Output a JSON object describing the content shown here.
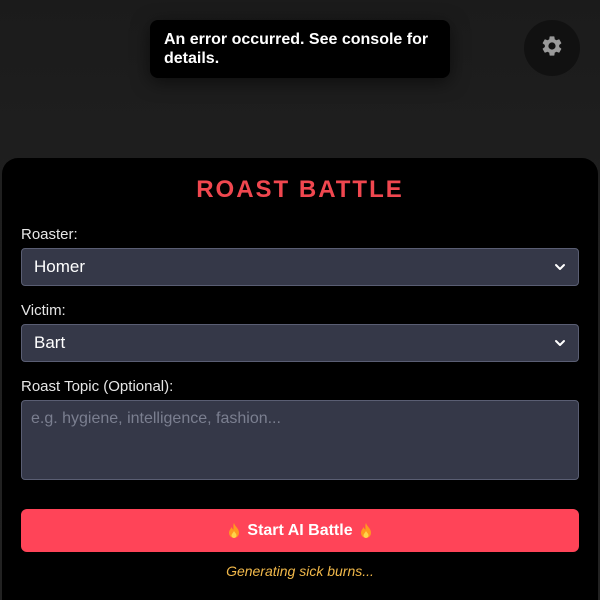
{
  "toast": {
    "message": "An error occurred. See console for details."
  },
  "settings": {
    "icon": "gear-icon"
  },
  "form": {
    "title": "ROAST BATTLE",
    "roaster_label": "Roaster:",
    "roaster_value": "Homer",
    "victim_label": "Victim:",
    "victim_value": "Bart",
    "topic_label": "Roast Topic (Optional):",
    "topic_placeholder": "e.g. hygiene, intelligence, fashion...",
    "topic_value": "",
    "start_label": "Start AI Battle",
    "status": "Generating sick burns..."
  },
  "colors": {
    "accent_title": "#f0474f",
    "button": "#ff4458",
    "field_bg": "#353848",
    "status": "#f2b94a"
  }
}
